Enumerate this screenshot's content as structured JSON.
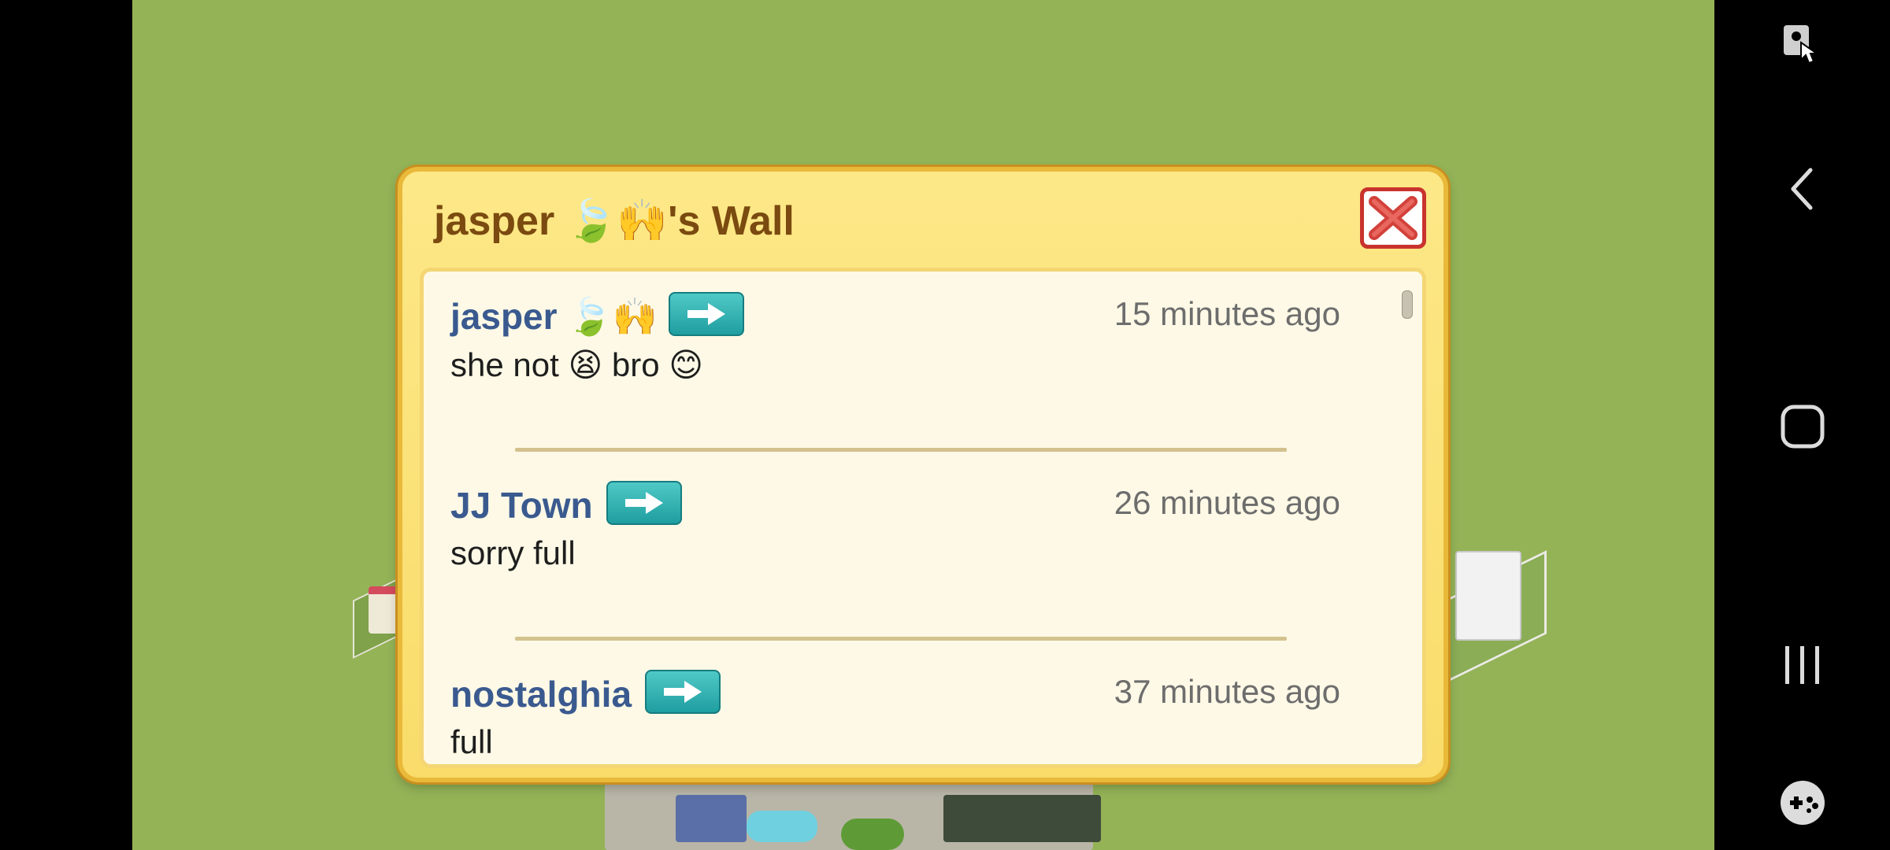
{
  "dialog": {
    "title": "jasper 🍃🙌's Wall",
    "close_icon": "close-x-icon"
  },
  "posts": [
    {
      "author": "jasper 🍃🙌",
      "time": "15 minutes ago",
      "message": "she not 😫 bro 😊"
    },
    {
      "author": "JJ Town",
      "time": "26 minutes ago",
      "message": "sorry full"
    },
    {
      "author": "nostalghia",
      "time": "37 minutes ago",
      "message": "full"
    }
  ],
  "nav": {
    "icons": [
      "touch-assist-icon",
      "back-icon",
      "home-icon",
      "recents-icon",
      "game-launcher-icon"
    ]
  },
  "colors": {
    "background_grass": "#94b357",
    "dialog": "#fde888",
    "author": "#3a5a8f",
    "close_border": "#c9332d"
  }
}
